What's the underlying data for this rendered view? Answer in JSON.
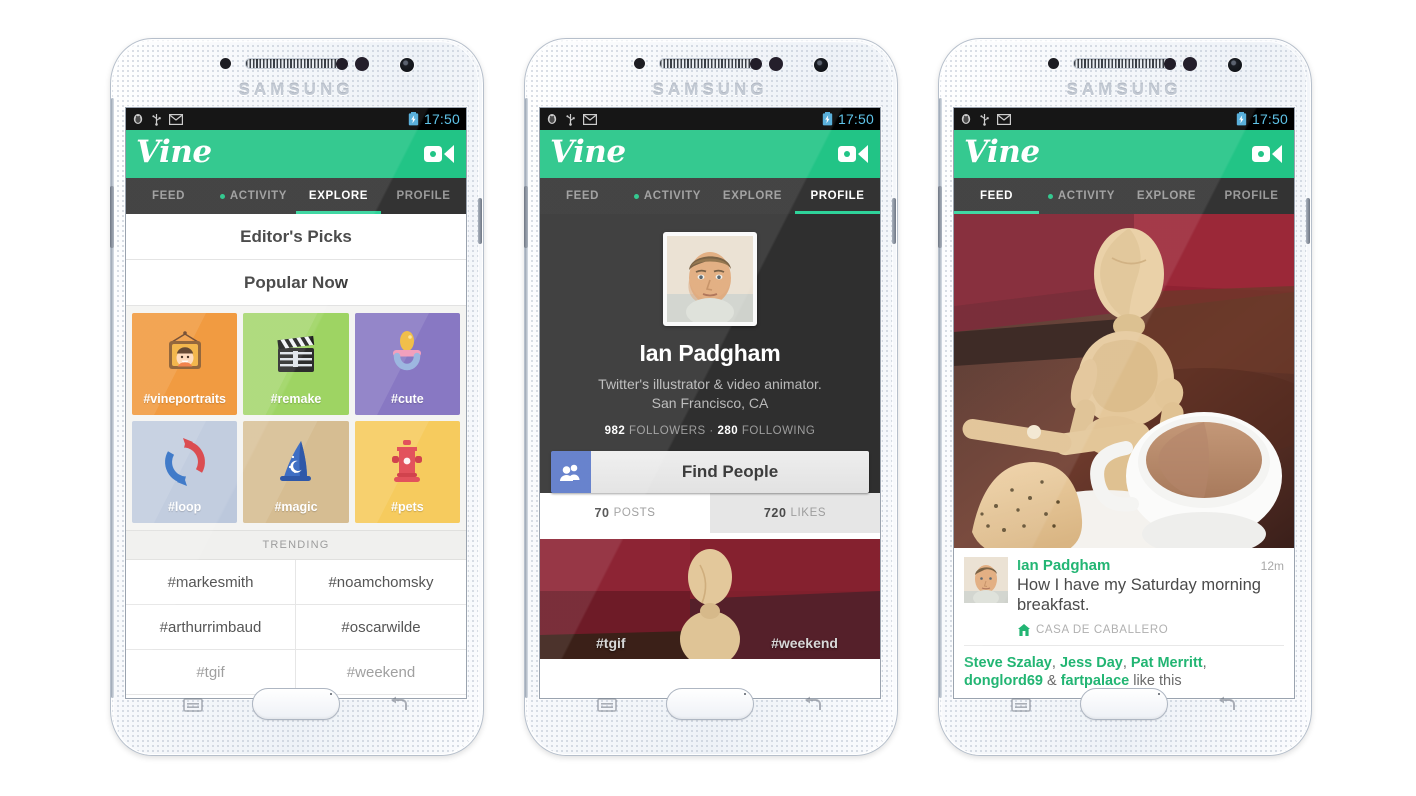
{
  "device": {
    "brand": "SAMSUNG",
    "home_button": "home-button",
    "menu_key": "menu-key",
    "back_key": "back-key"
  },
  "status_bar": {
    "time": "17:50",
    "icons": [
      "android-icon",
      "usb-icon",
      "gmail-icon"
    ],
    "battery": "battery-charging-icon",
    "time_color": "#5fc3e8"
  },
  "app": {
    "name": "Vine",
    "accent": "#22c486",
    "camera_button": "video-camera-icon"
  },
  "tabs": [
    {
      "label": "FEED",
      "dot": false
    },
    {
      "label": "ACTIVITY",
      "dot": true
    },
    {
      "label": "EXPLORE",
      "dot": false
    },
    {
      "label": "PROFILE",
      "dot": false
    }
  ],
  "phone1": {
    "active_tab": "EXPLORE",
    "rows": [
      "Editor's Picks",
      "Popular Now"
    ],
    "tiles": [
      {
        "label": "#vineportraits",
        "color": "#f0922f",
        "art": "portrait-frame-icon"
      },
      {
        "label": "#remake",
        "color": "#9ed463",
        "art": "clapperboard-icon"
      },
      {
        "label": "#cute",
        "color": "#8878c3",
        "art": "pacifier-icon"
      },
      {
        "label": "#loop",
        "color": "#bcc8dc",
        "art": "loop-arrows-icon"
      },
      {
        "label": "#magic",
        "color": "#d6bd92",
        "art": "wizard-hat-icon"
      },
      {
        "label": "#pets",
        "color": "#f6cb5e",
        "art": "fire-hydrant-icon"
      }
    ],
    "trending_header": "TRENDING",
    "trending": [
      {
        "tag": "#markesmith",
        "dim": false
      },
      {
        "tag": "#noamchomsky",
        "dim": false
      },
      {
        "tag": "#arthurrimbaud",
        "dim": false
      },
      {
        "tag": "#oscarwilde",
        "dim": false
      },
      {
        "tag": "#tgif",
        "dim": true
      },
      {
        "tag": "#weekend",
        "dim": true
      }
    ]
  },
  "phone2": {
    "active_tab": "PROFILE",
    "avatar": "user-avatar-portrait",
    "name": "Ian Padgham",
    "bio_line1": "Twitter's illustrator & video animator.",
    "bio_line2": "San Francisco, CA",
    "followers_count": "982",
    "followers_label": "FOLLOWERS",
    "stat_separator": "·",
    "following_count": "280",
    "following_label": "FOLLOWING",
    "find_people_label": "Find People",
    "find_people_icon": "people-icon",
    "posts_count": "70",
    "posts_label": "POSTS",
    "likes_count": "720",
    "likes_label": "LIKES",
    "video_tag_left": "#tgif",
    "video_tag_right": "#weekend"
  },
  "phone3": {
    "active_tab": "FEED",
    "post": {
      "avatar": "user-avatar-portrait",
      "user": "Ian Padgham",
      "time": "12m",
      "text": "How I have my Saturday morning breakfast.",
      "location_icon": "home-channel-icon",
      "location": "CASA DE CABALLERO",
      "likers": [
        {
          "name": "Steve Szalay",
          "sep": ", "
        },
        {
          "name": "Jess Day",
          "sep": ", "
        },
        {
          "name": "Pat Merritt",
          "sep": ", "
        },
        {
          "name": "donglord69",
          "sep": " & "
        },
        {
          "name": "fartpalace",
          "sep": " "
        }
      ],
      "likes_suffix": "like this"
    }
  }
}
